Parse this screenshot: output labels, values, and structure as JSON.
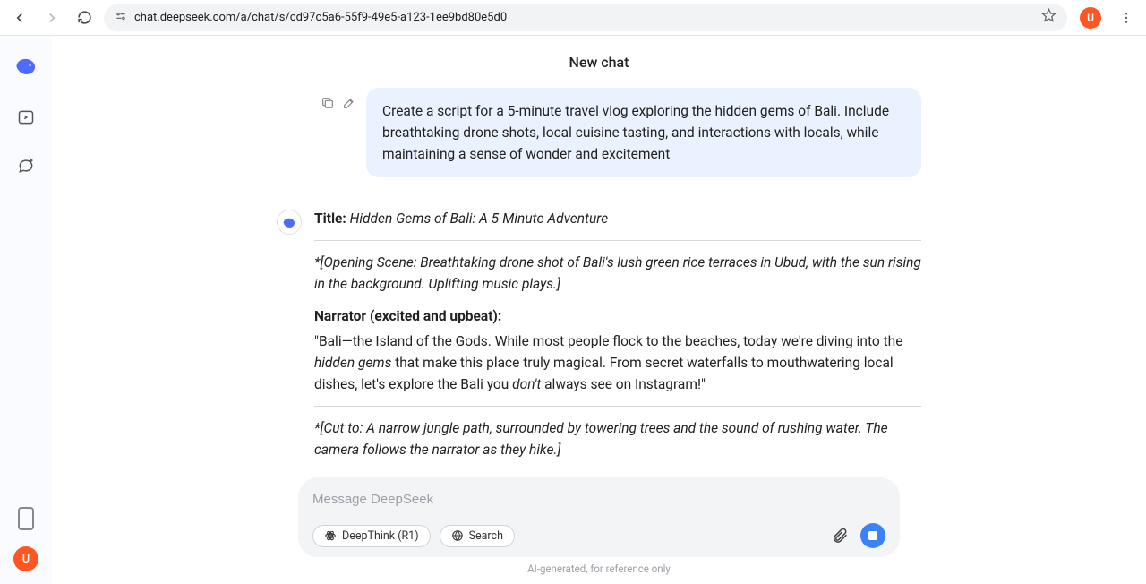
{
  "browser": {
    "url": "chat.deepseek.com/a/chat/s/cd97c5a6-55f9-49e5-a123-1ee9bd80e5d0",
    "profile_initial": "U"
  },
  "sidebar": {
    "user_initial": "U"
  },
  "header": {
    "title": "New chat"
  },
  "conversation": {
    "user_message": "Create a script for a 5-minute travel vlog exploring the hidden gems of Bali. Include breathtaking drone shots, local cuisine tasting, and interactions with locals, while maintaining a sense of wonder and excitement",
    "assistant": {
      "title_label": "Title:",
      "title_value": "Hidden Gems of Bali: A 5-Minute Adventure",
      "scene1": "*[Opening Scene: Breathtaking drone shot of Bali's lush green rice terraces in Ubud, with the sun rising in the background. Uplifting music plays.]",
      "narrator_label": "Narrator (excited and upbeat):",
      "narrator_pre": "\"Bali—the Island of the Gods. While most people flock to the beaches, today we're diving into the ",
      "narrator_em1": "hidden gems",
      "narrator_mid": " that make this place truly magical. From secret waterfalls to mouthwatering local dishes, let's explore the Bali you ",
      "narrator_em2": "don't",
      "narrator_post": " always see on Instagram!\"",
      "scene2": "*[Cut to: A narrow jungle path, surrounded by towering trees and the sound of rushing water. The camera follows the narrator as they hike.]"
    }
  },
  "input": {
    "placeholder": "Message DeepSeek",
    "deepthink_label": "DeepThink (R1)",
    "search_label": "Search",
    "disclaimer": "AI-generated, for reference only"
  }
}
